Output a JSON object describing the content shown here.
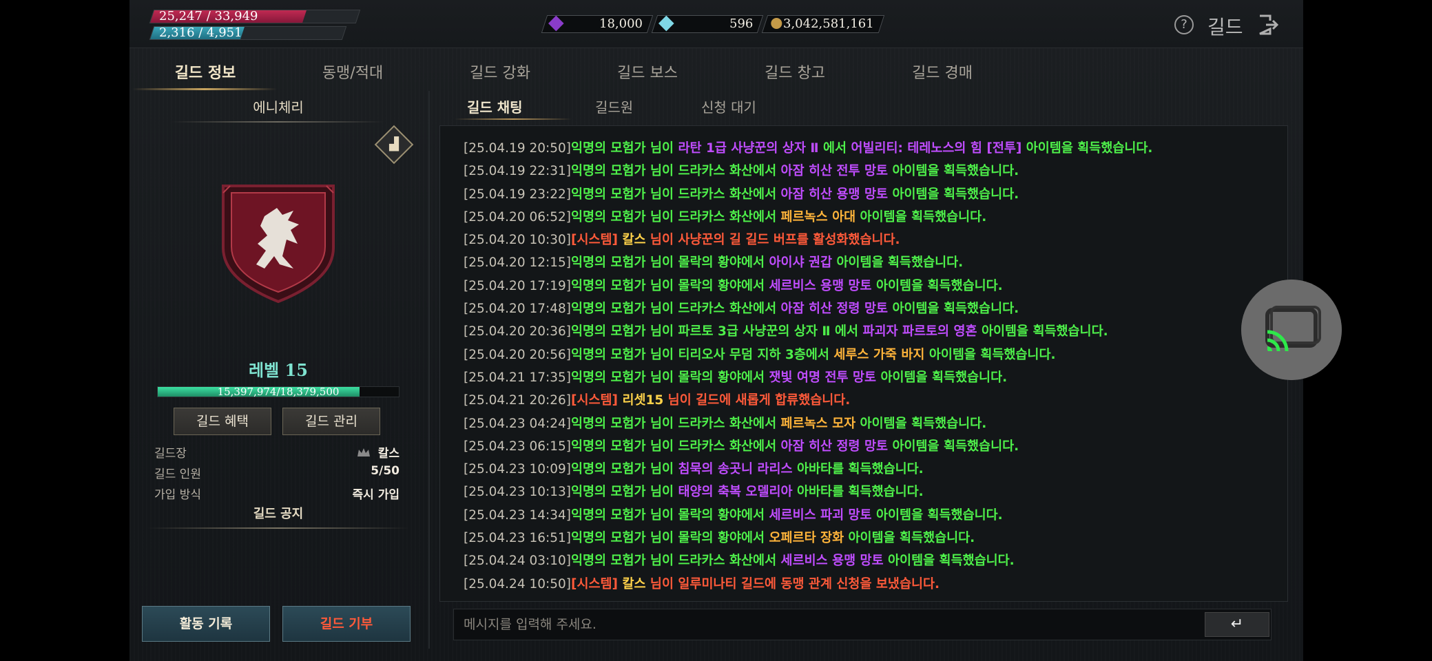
{
  "stats": {
    "hp": "25,247 / 33,949",
    "hp_fraction": 0.74,
    "mp": "2,316 / 4,951",
    "mp_fraction": 0.47
  },
  "currency": {
    "crystal": "18,000",
    "diamond": "596",
    "gold": "3,042,581,161"
  },
  "header": {
    "help_icon": "?",
    "title": "길드"
  },
  "main_tabs": [
    "길드 정보",
    "동맹/적대",
    "길드 강화",
    "길드 보스",
    "길드 창고",
    "길드 경매"
  ],
  "guild": {
    "name": "에니체리",
    "level": "레벨 15",
    "xp": "15,397,974/18,379,500",
    "xp_fraction": 0.838,
    "benefit_button": "길드 혜택",
    "manage_button": "길드 관리",
    "leader_label": "길드장",
    "leader_value": "칼스",
    "members_label": "길드 인원",
    "members_value": "5/50",
    "join_label": "가입 방식",
    "join_value": "즉시 가입",
    "notice_title": "길드 공지",
    "activity_button": "활동 기록",
    "donate_button": "길드 기부"
  },
  "sub_tabs": [
    "길드 채팅",
    "길드원",
    "신청 대기"
  ],
  "chat": [
    {
      "ts": "[25.04.19 20:50]",
      "parts": [
        [
          "g",
          "익명의 모험가 님이 "
        ],
        [
          "p",
          "라탄 1급 사냥꾼의 상자 Ⅱ"
        ],
        [
          "g",
          " 에서 "
        ],
        [
          "p",
          "어빌리티: 테레노스의 힘 [전투]"
        ],
        [
          "g",
          " 아이템을 획득했습니다."
        ]
      ]
    },
    {
      "ts": "[25.04.19 22:31]",
      "parts": [
        [
          "g",
          "익명의 모험가 님이 드라카스 화산에서 "
        ],
        [
          "p",
          "아잠 히산 전투 망토"
        ],
        [
          "g",
          " 아이템을 획득했습니다."
        ]
      ]
    },
    {
      "ts": "[25.04.19 23:22]",
      "parts": [
        [
          "g",
          "익명의 모험가 님이 드라카스 화산에서 "
        ],
        [
          "p",
          "아잠 히산 용맹 망토"
        ],
        [
          "g",
          " 아이템을 획득했습니다."
        ]
      ]
    },
    {
      "ts": "[25.04.20 06:52]",
      "parts": [
        [
          "g",
          "익명의 모험가 님이 드라카스 화산에서 "
        ],
        [
          "o",
          "페르녹스 아대"
        ],
        [
          "g",
          " 아이템을 획득했습니다."
        ]
      ]
    },
    {
      "ts": "[25.04.20 10:30]",
      "parts": [
        [
          "r",
          "[시스템] "
        ],
        [
          "y",
          "칼스"
        ],
        [
          "r",
          " 님이 사냥꾼의 길 길드 버프를 활성화했습니다."
        ]
      ]
    },
    {
      "ts": "[25.04.20 12:15]",
      "parts": [
        [
          "g",
          "익명의 모험가 님이 몰락의 황야에서 "
        ],
        [
          "p",
          "아이샤 권갑"
        ],
        [
          "g",
          " 아이템을 획득했습니다."
        ]
      ]
    },
    {
      "ts": "[25.04.20 17:19]",
      "parts": [
        [
          "g",
          "익명의 모험가 님이 몰락의 황야에서 "
        ],
        [
          "p",
          "세르비스 용맹 망토"
        ],
        [
          "g",
          " 아이템을 획득했습니다."
        ]
      ]
    },
    {
      "ts": "[25.04.20 17:48]",
      "parts": [
        [
          "g",
          "익명의 모험가 님이 드라카스 화산에서 "
        ],
        [
          "p",
          "아잠 히산 정령 망토"
        ],
        [
          "g",
          " 아이템을 획득했습니다."
        ]
      ]
    },
    {
      "ts": "[25.04.20 20:36]",
      "parts": [
        [
          "g",
          "익명의 모험가 님이 파르토 3급 사냥꾼의 상자 Ⅱ 에서 "
        ],
        [
          "p",
          "파괴자 파르토의 영혼"
        ],
        [
          "g",
          " 아이템을 획득했습니다."
        ]
      ]
    },
    {
      "ts": "[25.04.20 20:56]",
      "parts": [
        [
          "g",
          "익명의 모험가 님이 티리오사 무덤 지하 3층에서 "
        ],
        [
          "o",
          "세루스 가죽 바지"
        ],
        [
          "g",
          " 아이템을 획득했습니다."
        ]
      ]
    },
    {
      "ts": "[25.04.21 17:35]",
      "parts": [
        [
          "g",
          "익명의 모험가 님이 몰락의 황야에서 "
        ],
        [
          "p",
          "잿빛 여명 전투 망토"
        ],
        [
          "g",
          " 아이템을 획득했습니다."
        ]
      ]
    },
    {
      "ts": "[25.04.21 20:26]",
      "parts": [
        [
          "r",
          "[시스템] "
        ],
        [
          "y",
          "리셋15"
        ],
        [
          "r",
          " 님이 길드에 새롭게 합류했습니다."
        ]
      ]
    },
    {
      "ts": "[25.04.23 04:24]",
      "parts": [
        [
          "g",
          "익명의 모험가 님이 드라카스 화산에서 "
        ],
        [
          "o",
          "페르녹스 모자"
        ],
        [
          "g",
          " 아이템을 획득했습니다."
        ]
      ]
    },
    {
      "ts": "[25.04.23 06:15]",
      "parts": [
        [
          "g",
          "익명의 모험가 님이 드라카스 화산에서 "
        ],
        [
          "p",
          "아잠 히산 정령 망토"
        ],
        [
          "g",
          " 아이템을 획득했습니다."
        ]
      ]
    },
    {
      "ts": "[25.04.23 10:09]",
      "parts": [
        [
          "g",
          "익명의 모험가 님이 "
        ],
        [
          "p",
          "침묵의 송곳니 라리스"
        ],
        [
          "g",
          " 아바타를 획득했습니다."
        ]
      ]
    },
    {
      "ts": "[25.04.23 10:13]",
      "parts": [
        [
          "g",
          "익명의 모험가 님이 "
        ],
        [
          "p",
          "태양의 축복 오델리아"
        ],
        [
          "g",
          " 아바타를 획득했습니다."
        ]
      ]
    },
    {
      "ts": "[25.04.23 14:34]",
      "parts": [
        [
          "g",
          "익명의 모험가 님이 몰락의 황야에서 "
        ],
        [
          "p",
          "세르비스 파괴 망토"
        ],
        [
          "g",
          " 아이템을 획득했습니다."
        ]
      ]
    },
    {
      "ts": "[25.04.23 16:51]",
      "parts": [
        [
          "g",
          "익명의 모험가 님이 몰락의 황야에서 "
        ],
        [
          "o",
          "오페르타 장화"
        ],
        [
          "g",
          " 아이템을 획득했습니다."
        ]
      ]
    },
    {
      "ts": "[25.04.24 03:10]",
      "parts": [
        [
          "g",
          "익명의 모험가 님이 드라카스 화산에서 "
        ],
        [
          "p",
          "세르비스 용맹 망토"
        ],
        [
          "g",
          " 아이템을 획득했습니다."
        ]
      ]
    },
    {
      "ts": "[25.04.24 10:50]",
      "parts": [
        [
          "r",
          "[시스템] "
        ],
        [
          "y",
          "칼스"
        ],
        [
          "r",
          " 님이 일루미나티 길드에 동맹 관계 신청을 보냈습니다."
        ]
      ]
    }
  ],
  "input": {
    "placeholder": "메시지를 입력해 주세요.",
    "send_icon": "↵"
  },
  "colors": {
    "system": "#ff5a3a",
    "loot": "#4ef04a",
    "item_epic": "#c04dff",
    "item_legendary": "#ffb43a",
    "name": "#ffd24a",
    "level": "#7fe3d0"
  }
}
